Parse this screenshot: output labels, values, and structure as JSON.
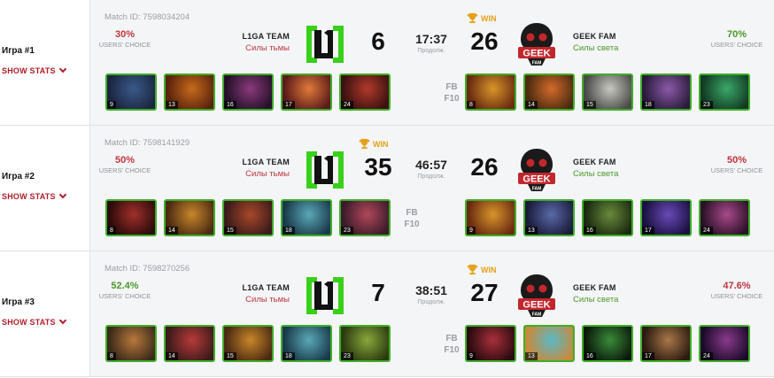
{
  "games": [
    {
      "label": "Игра #1",
      "show_stats": "SHOW STATS",
      "match_id": "Match ID: 7598034204",
      "left": {
        "pct": "30%",
        "choice": "USERS' CHOICE",
        "team": "L1GA TEAM",
        "side": "Силы тьмы",
        "score": "6",
        "choice_color": "red"
      },
      "right": {
        "pct": "70%",
        "choice": "USERS' CHOICE",
        "team": "GEEK FAM",
        "side": "Силы света",
        "score": "26",
        "choice_color": "green"
      },
      "duration": "17:37",
      "duration_label": "Продолж.",
      "win_label": "WIN",
      "winner": "right",
      "fb": "FB",
      "f10": "F10",
      "left_heroes": [
        {
          "num": "9",
          "icon": "hero-portrait-icon",
          "c1": "#3a5a8a",
          "c2": "#1b2540"
        },
        {
          "num": "13",
          "icon": "hero-portrait-icon",
          "c1": "#c76a1c",
          "c2": "#5a230c"
        },
        {
          "num": "16",
          "icon": "hero-portrait-icon",
          "c1": "#8a3a7a",
          "c2": "#24102a"
        },
        {
          "num": "17",
          "icon": "hero-portrait-icon",
          "c1": "#e07a3a",
          "c2": "#5a1a1a"
        },
        {
          "num": "24",
          "icon": "hero-portrait-icon",
          "c1": "#b03a2a",
          "c2": "#3a1010"
        }
      ],
      "right_heroes": [
        {
          "num": "8",
          "icon": "hero-portrait-icon",
          "c1": "#d8962a",
          "c2": "#6a2a10"
        },
        {
          "num": "14",
          "icon": "hero-portrait-icon",
          "c1": "#d46a2a",
          "c2": "#4a2a10"
        },
        {
          "num": "15",
          "icon": "hero-portrait-icon",
          "c1": "#c8c8c0",
          "c2": "#4a4a48"
        },
        {
          "num": "18",
          "icon": "hero-portrait-icon",
          "c1": "#8a5aa8",
          "c2": "#2a1a3a"
        },
        {
          "num": "23",
          "icon": "hero-portrait-icon",
          "c1": "#3aa868",
          "c2": "#123a24"
        }
      ]
    },
    {
      "label": "Игра #2",
      "show_stats": "SHOW STATS",
      "match_id": "Match ID: 7598141929",
      "left": {
        "pct": "50%",
        "choice": "USERS' CHOICE",
        "team": "L1GA TEAM",
        "side": "Силы тьмы",
        "score": "35",
        "choice_color": "red"
      },
      "right": {
        "pct": "50%",
        "choice": "USERS' CHOICE",
        "team": "GEEK FAM",
        "side": "Силы света",
        "score": "26",
        "choice_color": "red"
      },
      "duration": "46:57",
      "duration_label": "Продолж.",
      "win_label": "WIN",
      "winner": "left",
      "fb": "FB",
      "f10": "F10",
      "left_heroes": [
        {
          "num": "8",
          "icon": "hero-portrait-icon",
          "c1": "#a0302a",
          "c2": "#2a0a0a"
        },
        {
          "num": "14",
          "icon": "hero-portrait-icon",
          "c1": "#c8862a",
          "c2": "#4a2a12"
        },
        {
          "num": "15",
          "icon": "hero-portrait-icon",
          "c1": "#a8482a",
          "c2": "#3a1a1a"
        },
        {
          "num": "18",
          "icon": "hero-portrait-icon",
          "c1": "#5aa8b8",
          "c2": "#1a3a4a"
        },
        {
          "num": "23",
          "icon": "hero-portrait-icon",
          "c1": "#b0485a",
          "c2": "#3a1a2a"
        }
      ],
      "right_heroes": [
        {
          "num": "9",
          "icon": "hero-portrait-icon",
          "c1": "#d8962a",
          "c2": "#6a2a10"
        },
        {
          "num": "13",
          "icon": "hero-portrait-icon",
          "c1": "#5a6aa8",
          "c2": "#1a1a3a"
        },
        {
          "num": "16",
          "icon": "hero-portrait-icon",
          "c1": "#6a8a3a",
          "c2": "#1a2a10"
        },
        {
          "num": "17",
          "icon": "hero-portrait-icon",
          "c1": "#6a4ab8",
          "c2": "#1a1040"
        },
        {
          "num": "24",
          "icon": "hero-portrait-icon",
          "c1": "#a84a8a",
          "c2": "#2a1028"
        }
      ]
    },
    {
      "label": "Игра #3",
      "show_stats": "SHOW STATS",
      "match_id": "Match ID: 7598270256",
      "left": {
        "pct": "52.4%",
        "choice": "USERS' CHOICE",
        "team": "L1GA TEAM",
        "side": "Силы тьмы",
        "score": "7",
        "choice_color": "green"
      },
      "right": {
        "pct": "47.6%",
        "choice": "USERS' CHOICE",
        "team": "GEEK FAM",
        "side": "Силы света",
        "score": "27",
        "choice_color": "red"
      },
      "duration": "38:51",
      "duration_label": "Продолж.",
      "win_label": "WIN",
      "winner": "right",
      "fb": "FB",
      "f10": "F10",
      "left_heroes": [
        {
          "num": "8",
          "icon": "hero-portrait-icon",
          "c1": "#b8783a",
          "c2": "#3a2a1a"
        },
        {
          "num": "14",
          "icon": "hero-portrait-icon",
          "c1": "#b83a3a",
          "c2": "#3a1a1a"
        },
        {
          "num": "15",
          "icon": "hero-portrait-icon",
          "c1": "#c8862a",
          "c2": "#4a2a12"
        },
        {
          "num": "18",
          "icon": "hero-portrait-icon",
          "c1": "#5aa8b8",
          "c2": "#1a3a4a"
        },
        {
          "num": "23",
          "icon": "hero-portrait-icon",
          "c1": "#8aa83a",
          "c2": "#2a3a10"
        }
      ],
      "right_heroes": [
        {
          "num": "9",
          "icon": "hero-portrait-icon",
          "c1": "#a8303a",
          "c2": "#2a0a10"
        },
        {
          "num": "13",
          "icon": "hero-portrait-icon",
          "c1": "#5ab8c8",
          "c2": "#c88a3a"
        },
        {
          "num": "16",
          "icon": "hero-portrait-icon",
          "c1": "#3a8a3a",
          "c2": "#0a1a0a"
        },
        {
          "num": "17",
          "icon": "hero-portrait-icon",
          "c1": "#a8784a",
          "c2": "#2a1a10"
        },
        {
          "num": "24",
          "icon": "hero-portrait-icon",
          "c1": "#8a3a8a",
          "c2": "#1a0a2a"
        }
      ]
    }
  ],
  "colors": {
    "accent_red": "#b01e2a",
    "green": "#3fae2a",
    "gold": "#e3a21a"
  }
}
